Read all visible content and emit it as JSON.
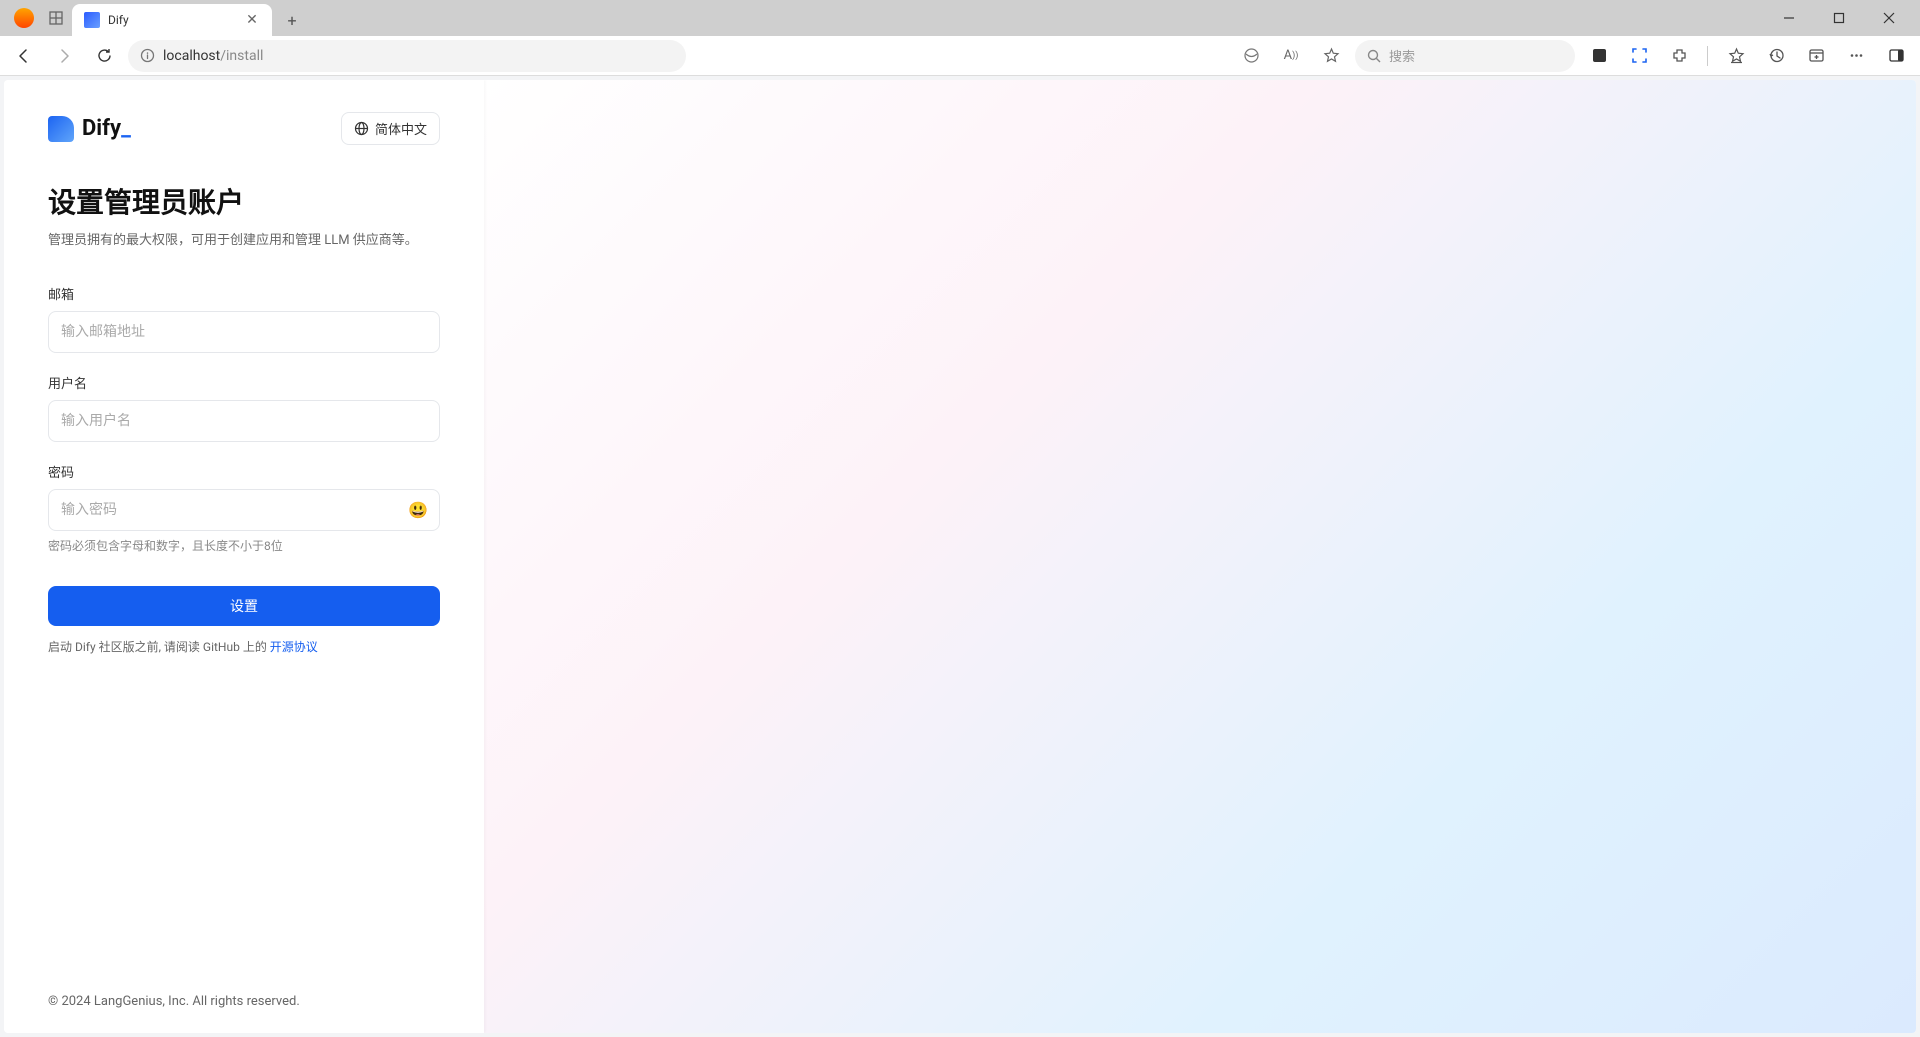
{
  "browser": {
    "tab_title": "Dify",
    "url_host": "localhost",
    "url_path": "/install",
    "search_placeholder": "搜索"
  },
  "header": {
    "logo_text": "Dify",
    "language_label": "简体中文"
  },
  "form": {
    "title": "设置管理员账户",
    "subtitle": "管理员拥有的最大权限，可用于创建应用和管理 LLM 供应商等。",
    "email_label": "邮箱",
    "email_placeholder": "输入邮箱地址",
    "username_label": "用户名",
    "username_placeholder": "输入用户名",
    "password_label": "密码",
    "password_placeholder": "输入密码",
    "password_hint": "密码必须包含字母和数字，且长度不小于8位",
    "submit_label": "设置",
    "agree_prefix": "启动 Dify 社区版之前, 请阅读 GitHub 上的 ",
    "agree_link": "开源协议"
  },
  "footer": {
    "copyright": "© 2024 LangGenius, Inc. All rights reserved."
  }
}
